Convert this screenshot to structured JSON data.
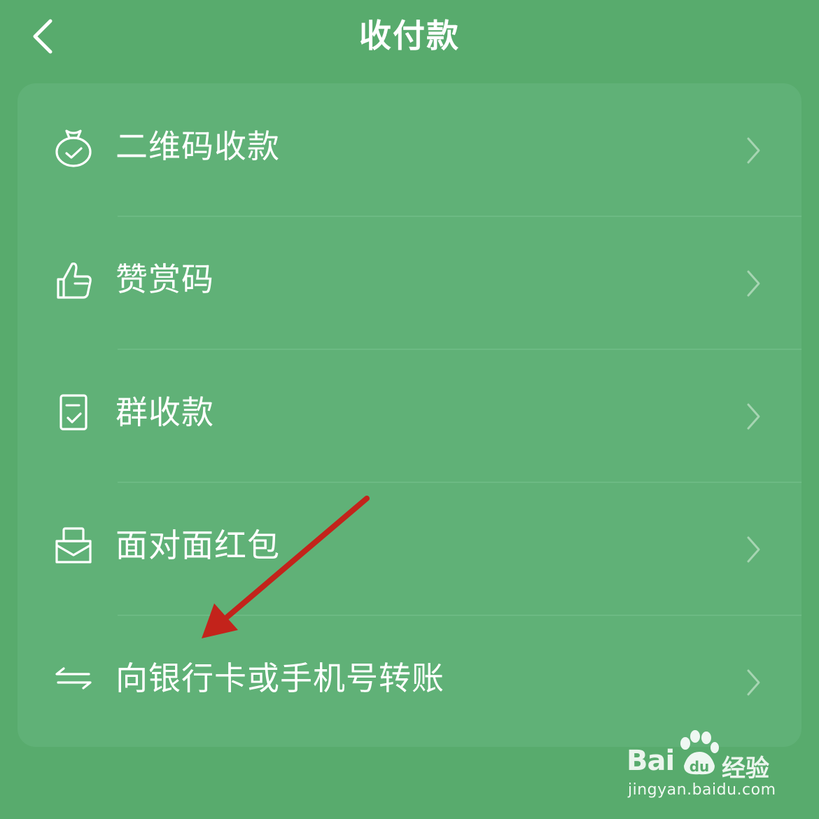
{
  "header": {
    "title": "收付款"
  },
  "menu": {
    "items": [
      {
        "label": "二维码收款",
        "icon": "money-bag-icon"
      },
      {
        "label": "赞赏码",
        "icon": "thumbs-up-icon"
      },
      {
        "label": "群收款",
        "icon": "group-receipt-icon"
      },
      {
        "label": "面对面红包",
        "icon": "red-packet-icon"
      },
      {
        "label": "向银行卡或手机号转账",
        "icon": "transfer-arrows-icon"
      }
    ]
  },
  "watermark": {
    "brand_prefix": "Bai",
    "brand_suffix": "经验",
    "url": "jingyan.baidu.com"
  },
  "colors": {
    "background": "#58ab6d",
    "card": "#60b177",
    "annotation_arrow": "#c3231b"
  }
}
